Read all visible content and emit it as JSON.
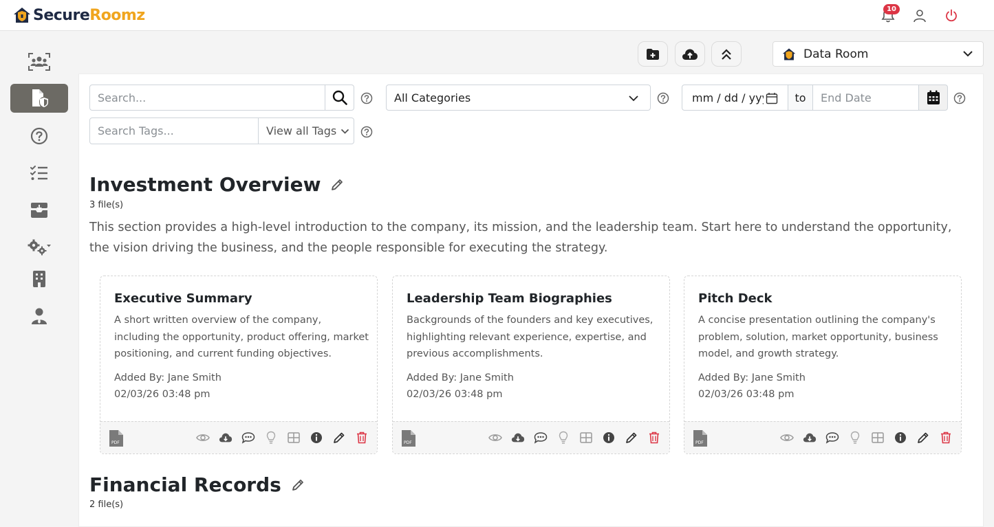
{
  "brand": {
    "part1": "Secure",
    "part2": "Roomz"
  },
  "header": {
    "notification_count": "10"
  },
  "room_selector": {
    "value": "Data Room"
  },
  "filters": {
    "search_placeholder": "Search...",
    "category_value": "All Categories",
    "start_date_value": "mm / dd / yyyy",
    "to_label": "to",
    "end_date_placeholder": "End Date",
    "tags_placeholder": "Search Tags...",
    "view_tags_label": "View all Tags"
  },
  "sections": [
    {
      "title": "Investment Overview",
      "file_count": "3 file(s)",
      "description": "This section provides a high-level introduction to the company, its mission, and the leadership team. Start here to understand the opportunity, the vision driving the business, and the people responsible for executing the strategy.",
      "cards": [
        {
          "title": "Executive Summary",
          "description": "A short written overview of the company, including the opportunity, product offering, market positioning, and current funding objectives.",
          "added_by": "Added By: Jane Smith",
          "date": "02/03/26 03:48 pm"
        },
        {
          "title": "Leadership Team Biographies",
          "description": "Backgrounds of the founders and key executives, highlighting relevant experience, expertise, and previous accomplishments.",
          "added_by": "Added By: Jane Smith",
          "date": "02/03/26 03:48 pm"
        },
        {
          "title": "Pitch Deck",
          "description": "A concise presentation outlining the company's problem, solution, market opportunity, business model, and growth strategy.",
          "added_by": "Added By: Jane Smith",
          "date": "02/03/26 03:48 pm"
        }
      ]
    },
    {
      "title": "Financial Records",
      "file_count": "2 file(s)"
    }
  ],
  "file_type_label": "PDF",
  "colors": {
    "accent": "#f0a51e",
    "brand_dark": "#1f2a44",
    "danger": "#dc3545",
    "sidebar_active": "#6c6a64"
  },
  "icons": {
    "sidebar": [
      "users-group-icon",
      "file-shield-icon",
      "question-circle-icon",
      "checklist-icon",
      "inbox-download-icon",
      "gears-icon",
      "building-icon",
      "user-tie-icon"
    ],
    "card_actions": [
      "eye-icon",
      "cloud-download-icon",
      "comment-icon",
      "lightbulb-icon",
      "table-icon",
      "info-circle-icon",
      "pencil-icon",
      "trash-icon"
    ]
  }
}
